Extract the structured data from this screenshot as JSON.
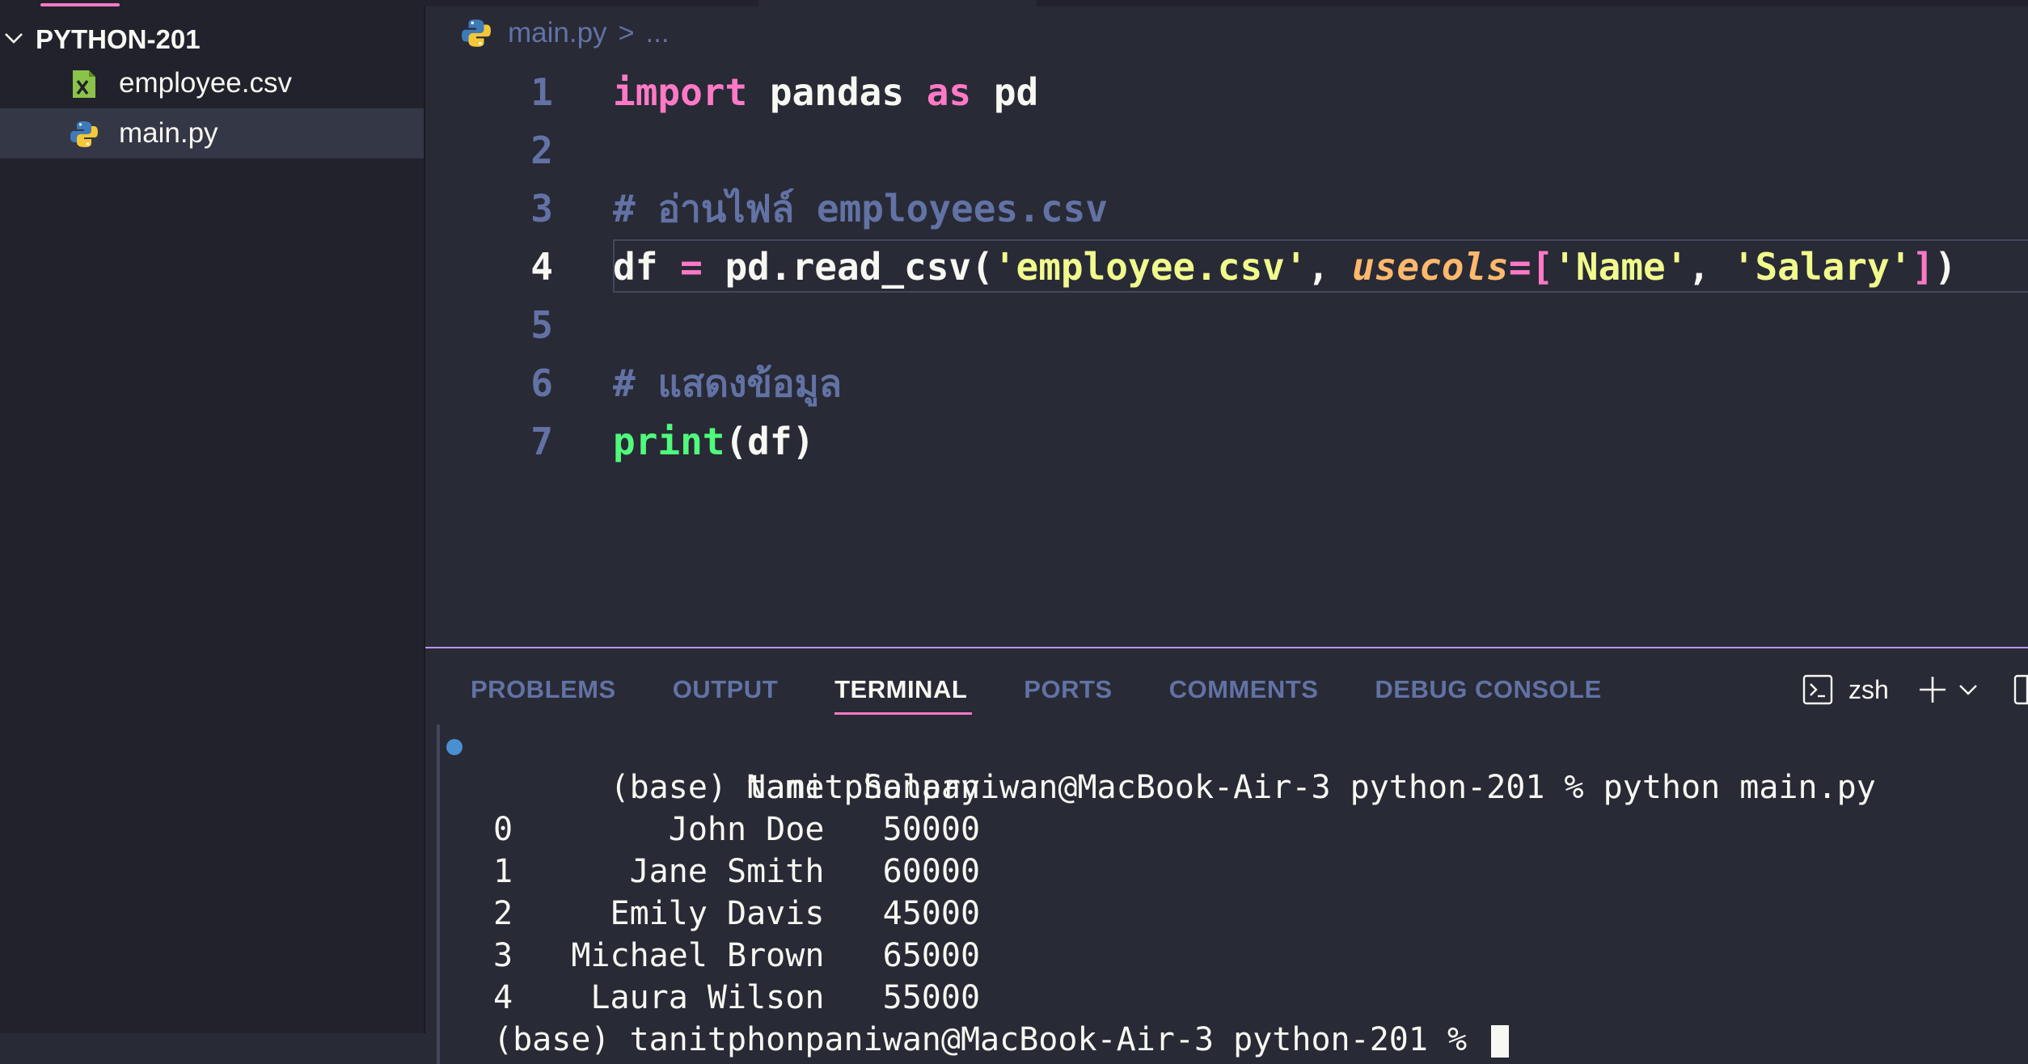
{
  "explorer": {
    "folder": "PYTHON-201",
    "files": [
      {
        "label": "employee.csv",
        "icon": "csv-file-icon"
      },
      {
        "label": "main.py",
        "icon": "python-file-icon",
        "selected": true
      }
    ]
  },
  "breadcrumb": {
    "file": "main.py",
    "separator": ">",
    "rest": "..."
  },
  "code": {
    "active_line": 4,
    "lines": [
      {
        "n": "1",
        "tokens": [
          [
            "kw",
            "import"
          ],
          [
            "id",
            " pandas "
          ],
          [
            "kw",
            "as"
          ],
          [
            "id",
            " pd"
          ]
        ]
      },
      {
        "n": "2",
        "tokens": []
      },
      {
        "n": "3",
        "tokens": [
          [
            "cm",
            "# อ่านไฟล์ employees.csv"
          ]
        ]
      },
      {
        "n": "4",
        "tokens": [
          [
            "id",
            "df "
          ],
          [
            "kw",
            "="
          ],
          [
            "id",
            " pd.read_csv("
          ],
          [
            "str",
            "'employee.csv'"
          ],
          [
            "id",
            ", "
          ],
          [
            "par",
            "usecols"
          ],
          [
            "kw",
            "="
          ],
          [
            "br",
            "["
          ],
          [
            "str",
            "'Name'"
          ],
          [
            "id",
            ", "
          ],
          [
            "str",
            "'Salary'"
          ],
          [
            "br",
            "]"
          ],
          [
            "id",
            ")"
          ]
        ]
      },
      {
        "n": "5",
        "tokens": []
      },
      {
        "n": "6",
        "tokens": [
          [
            "cm",
            "# แสดงข้อมูล"
          ]
        ]
      },
      {
        "n": "7",
        "tokens": [
          [
            "fn",
            "print"
          ],
          [
            "id",
            "(df)"
          ]
        ]
      }
    ]
  },
  "panel": {
    "tabs": [
      "PROBLEMS",
      "OUTPUT",
      "TERMINAL",
      "PORTS",
      "COMMENTS",
      "DEBUG CONSOLE"
    ],
    "active_tab": "TERMINAL",
    "shell_name": "zsh"
  },
  "terminal": {
    "lines": [
      "(base) tanitphonpaniwan@MacBook-Air-3 python-201 % python main.py",
      "             Name  Salary",
      "0        John Doe   50000",
      "1      Jane Smith   60000",
      "2     Emily Davis   45000",
      "3   Michael Brown   65000",
      "4    Laura Wilson   55000",
      "(base) tanitphonpaniwan@MacBook-Air-3 python-201 % "
    ]
  },
  "colors": {
    "background": "#282a36",
    "sidebar": "#21222c",
    "accent": "#ff79c6",
    "keyword": "#ff79c6",
    "string": "#f1fa8c",
    "comment": "#6272a4",
    "function": "#50fa7b",
    "parameter": "#ffb86c"
  }
}
